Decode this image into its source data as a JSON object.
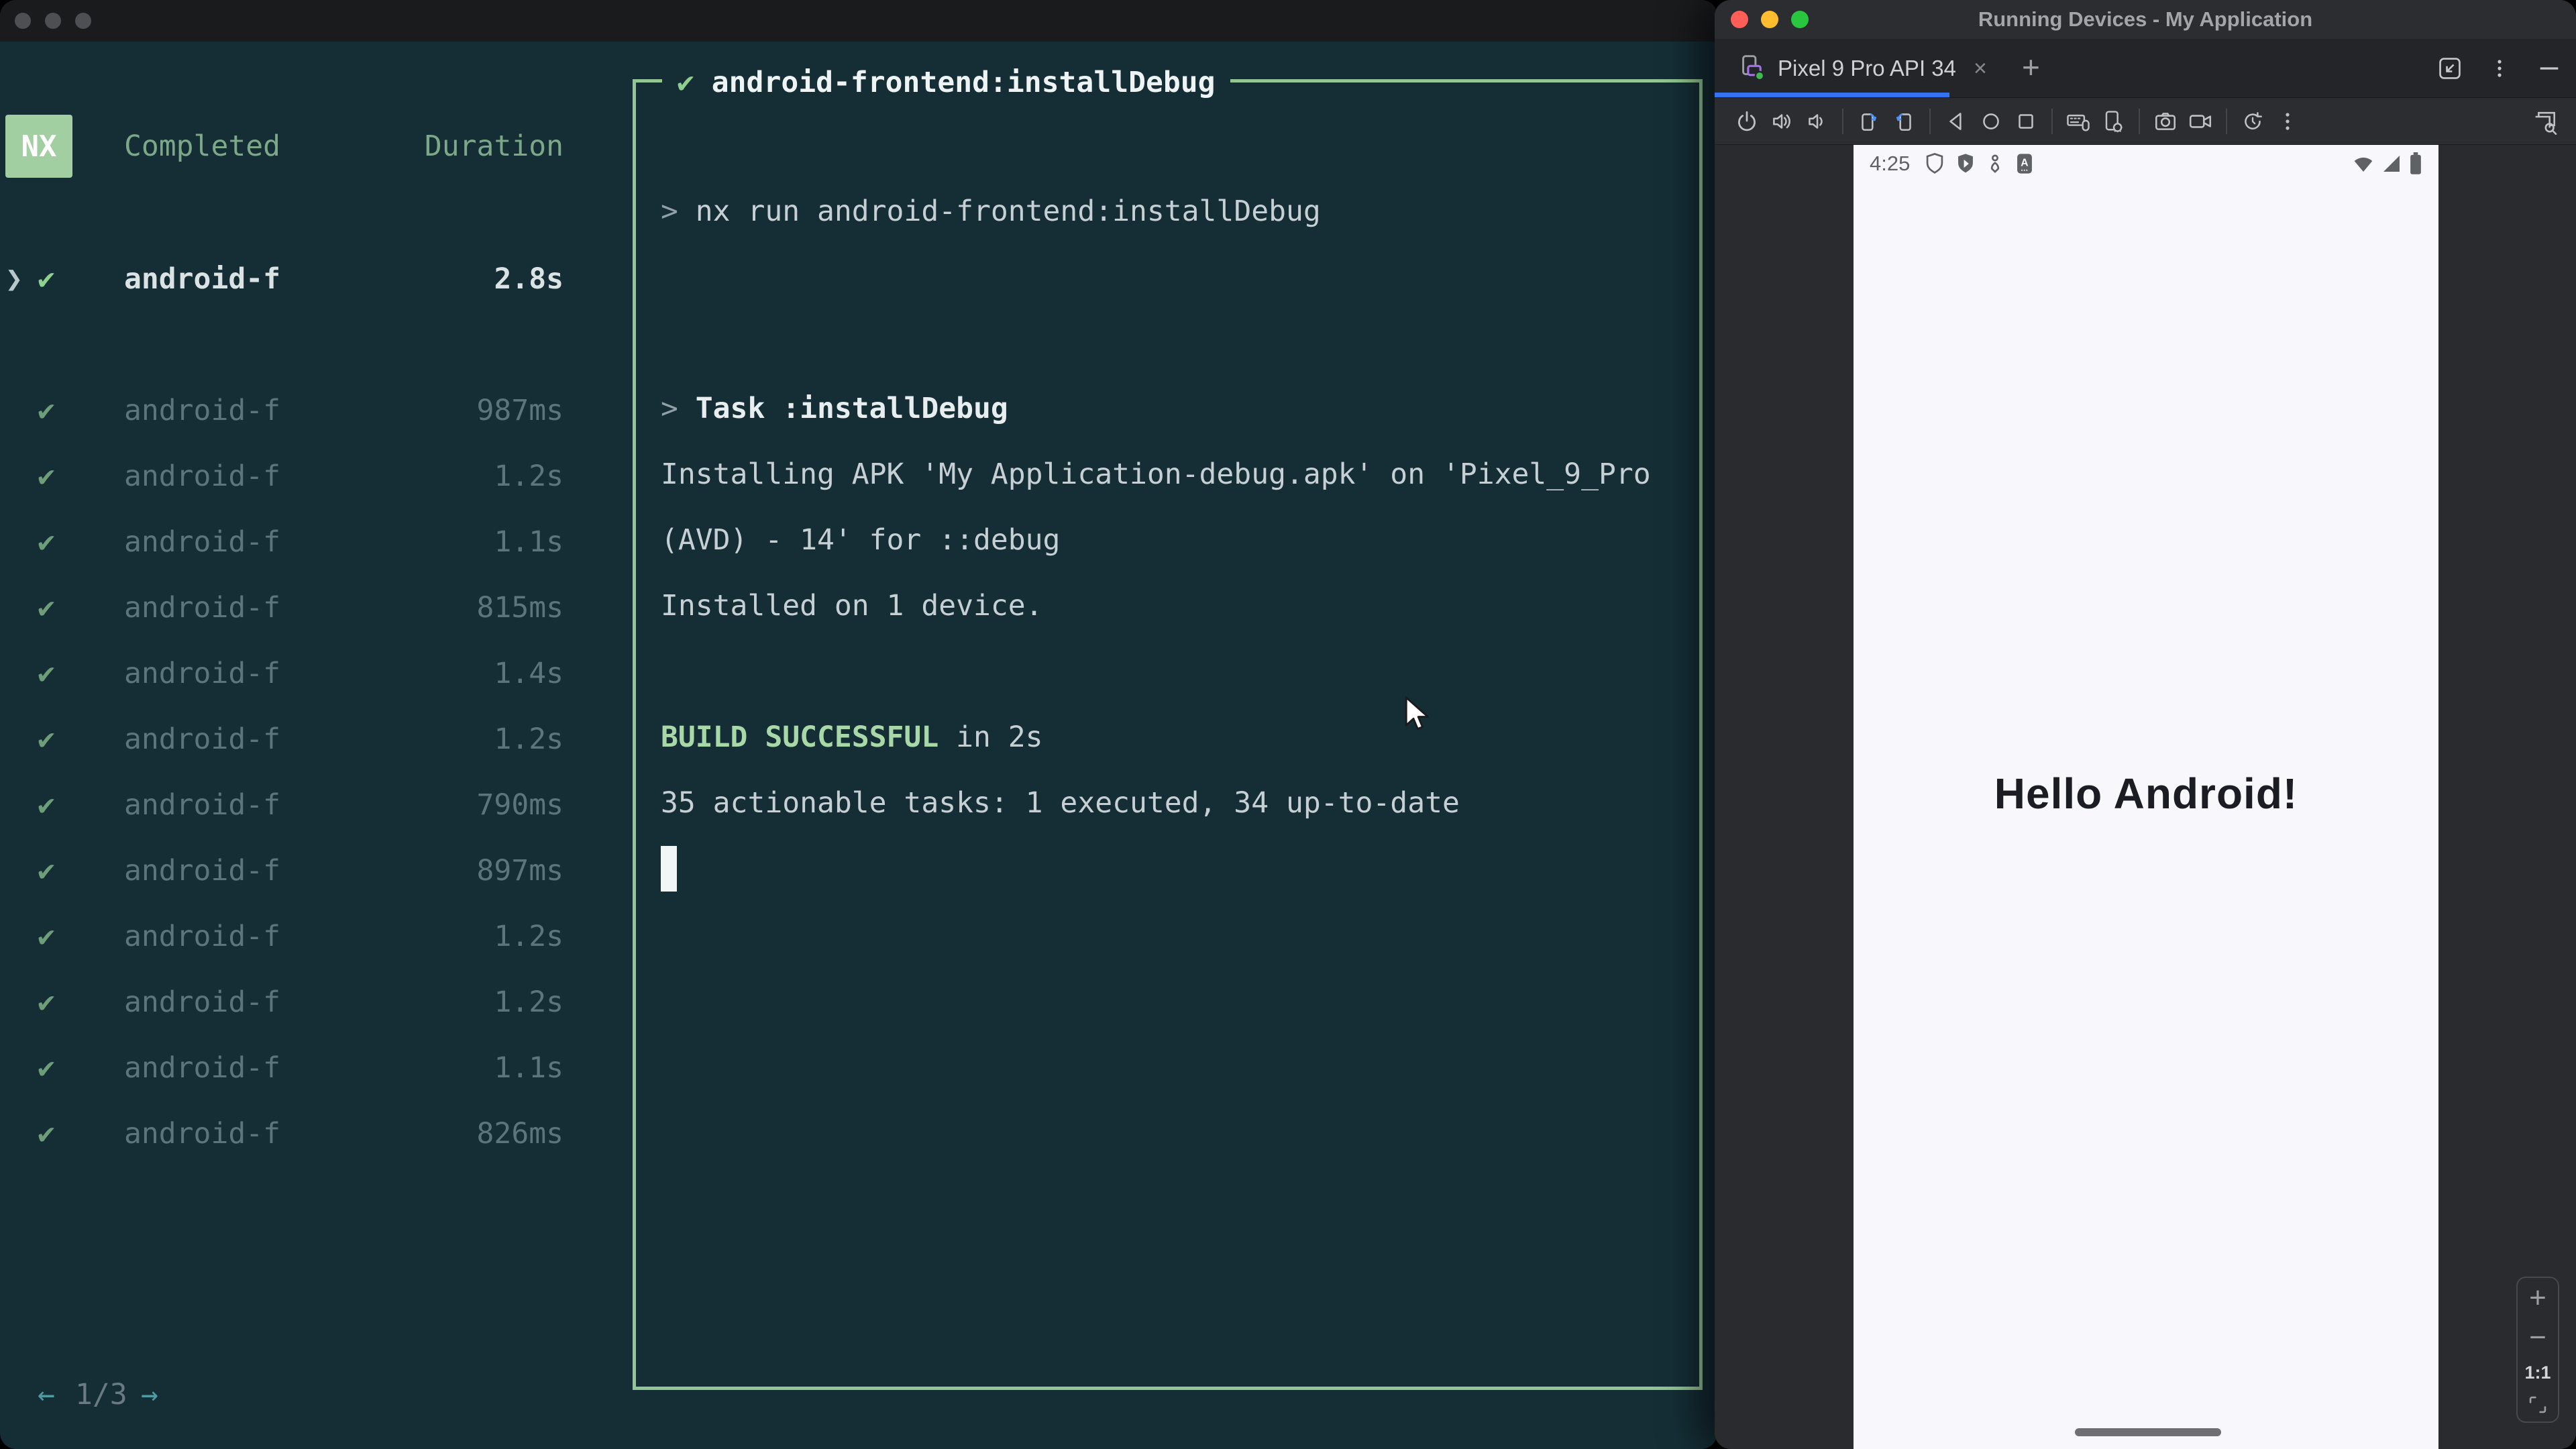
{
  "left_window": {
    "list": {
      "logo": "NX",
      "header": {
        "completed": "Completed",
        "duration": "Duration"
      },
      "selected_task": {
        "caret": "❯",
        "check": "✔",
        "name": "android-f",
        "duration": "2.8s"
      },
      "tasks": [
        {
          "check": "✔",
          "name": "android-f",
          "duration": "987ms"
        },
        {
          "check": "✔",
          "name": "android-f",
          "duration": "1.2s"
        },
        {
          "check": "✔",
          "name": "android-f",
          "duration": "1.1s"
        },
        {
          "check": "✔",
          "name": "android-f",
          "duration": "815ms"
        },
        {
          "check": "✔",
          "name": "android-f",
          "duration": "1.4s"
        },
        {
          "check": "✔",
          "name": "android-f",
          "duration": "1.2s"
        },
        {
          "check": "✔",
          "name": "android-f",
          "duration": "790ms"
        },
        {
          "check": "✔",
          "name": "android-f",
          "duration": "897ms"
        },
        {
          "check": "✔",
          "name": "android-f",
          "duration": "1.2s"
        },
        {
          "check": "✔",
          "name": "android-f",
          "duration": "1.2s"
        },
        {
          "check": "✔",
          "name": "android-f",
          "duration": "1.1s"
        },
        {
          "check": "✔",
          "name": "android-f",
          "duration": "826ms"
        }
      ],
      "pagination": {
        "prev": "←",
        "label": "1/3",
        "next": "→"
      }
    },
    "output": {
      "check": "✔",
      "title": "android-frontend:installDebug",
      "lines": [
        {
          "segments": [
            {
              "text": "> ",
              "style": "dim"
            },
            {
              "text": "nx run android-frontend:installDebug",
              "style": "reg"
            }
          ]
        },
        {
          "segments": []
        },
        {
          "segments": []
        },
        {
          "segments": [
            {
              "text": "> ",
              "style": "dim"
            },
            {
              "text": "Task :installDebug",
              "style": "bold"
            }
          ]
        },
        {
          "segments": [
            {
              "text": "Installing APK 'My Application-debug.apk' on 'Pixel_9_Pro",
              "style": "reg"
            }
          ]
        },
        {
          "segments": [
            {
              "text": "(AVD) - 14' for ::debug",
              "style": "reg"
            }
          ]
        },
        {
          "segments": [
            {
              "text": "Installed on 1 device.",
              "style": "reg"
            }
          ]
        },
        {
          "segments": []
        },
        {
          "segments": [
            {
              "text": "BUILD SUCCESSFUL",
              "style": "green-bold"
            },
            {
              "text": " in 2s",
              "style": "reg"
            }
          ]
        },
        {
          "segments": [
            {
              "text": "35 actionable tasks: 1 executed, 34 up-to-date",
              "style": "reg"
            }
          ]
        },
        {
          "cursor": true,
          "segments": []
        }
      ]
    }
  },
  "right_window": {
    "title": "Running Devices - My Application",
    "tabs": {
      "active_tab": "Pixel 9 Pro API 34",
      "close": "×",
      "new_tab": "+"
    },
    "toolbar": {
      "icons": [
        "power",
        "volume-up",
        "volume-down",
        "rotate-left",
        "rotate-right",
        "back",
        "home",
        "overview",
        "hardware-input",
        "device-settings",
        "screenshot",
        "screen-record",
        "snapshots",
        "more",
        "window-zoom"
      ]
    },
    "emulator": {
      "status_bar": {
        "time": "4:25"
      },
      "content": {
        "greeting": "Hello Android!"
      },
      "zoom_controls": {
        "zoom_in": "+",
        "zoom_out": "−",
        "actual_size": "1:1",
        "fit": "fit-to-window"
      }
    },
    "accent_colors": {
      "tab_underline": "#3574f0",
      "device_online": "#3fba50",
      "device_icon": "#a571e8"
    }
  },
  "terminal_colors": {
    "background": "#152e36",
    "success_green": "#a8d8a8",
    "border_green": "#93c493",
    "nx_logo_bg": "#a2cfa2"
  }
}
